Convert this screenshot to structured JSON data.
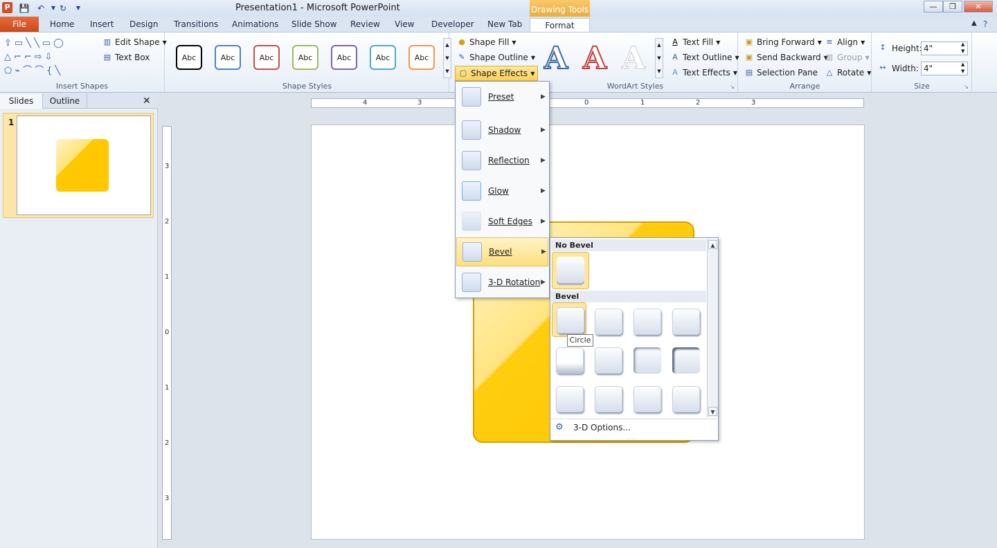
{
  "window": {
    "title": "Presentation1 - Microsoft PowerPoint",
    "context_tab_group": "Drawing Tools"
  },
  "tabs": {
    "file": "File",
    "items": [
      "Home",
      "Insert",
      "Design",
      "Transitions",
      "Animations",
      "Slide Show",
      "Review",
      "View",
      "Developer",
      "New Tab"
    ],
    "format": "Format"
  },
  "ribbon": {
    "insert_shapes": {
      "label": "Insert Shapes",
      "edit_shape": "Edit Shape",
      "text_box": "Text Box"
    },
    "shape_styles": {
      "label": "Shape Styles",
      "swatch_text": "Abc",
      "swatch_colors": [
        "#000000",
        "#4f81bd",
        "#c0504d",
        "#9bbb59",
        "#8064a2",
        "#4bacc6",
        "#f79646"
      ],
      "shape_fill": "Shape Fill",
      "shape_outline": "Shape Outline",
      "shape_effects": "Shape Effects"
    },
    "wordart": {
      "label": "WordArt Styles",
      "text_fill": "Text Fill",
      "text_outline": "Text Outline",
      "text_effects": "Text Effects",
      "glyph": "A"
    },
    "arrange": {
      "label": "Arrange",
      "bring_forward": "Bring Forward",
      "send_backward": "Send Backward",
      "selection_pane": "Selection Pane",
      "align": "Align",
      "group": "Group",
      "rotate": "Rotate"
    },
    "size": {
      "label": "Size",
      "height_label": "Height:",
      "height_value": "4\"",
      "width_label": "Width:",
      "width_value": "4\""
    }
  },
  "slides_pane": {
    "slides_tab": "Slides",
    "outline_tab": "Outline",
    "slide_number": "1"
  },
  "rulers": {
    "h_left": [
      "4",
      "3"
    ],
    "h_zero": "0",
    "h_right": [
      "1",
      "2",
      "3"
    ],
    "v_labels": [
      "3",
      "2",
      "1",
      "0",
      "1",
      "2",
      "3"
    ]
  },
  "shape_effects_menu": {
    "items": [
      "Preset",
      "Shadow",
      "Reflection",
      "Glow",
      "Soft Edges",
      "Bevel",
      "3-D Rotation"
    ],
    "highlighted": "Bevel"
  },
  "bevel_gallery": {
    "no_bevel_header": "No Bevel",
    "bevel_header": "Bevel",
    "options_label": "3-D Options...",
    "tooltip": "Circle"
  }
}
